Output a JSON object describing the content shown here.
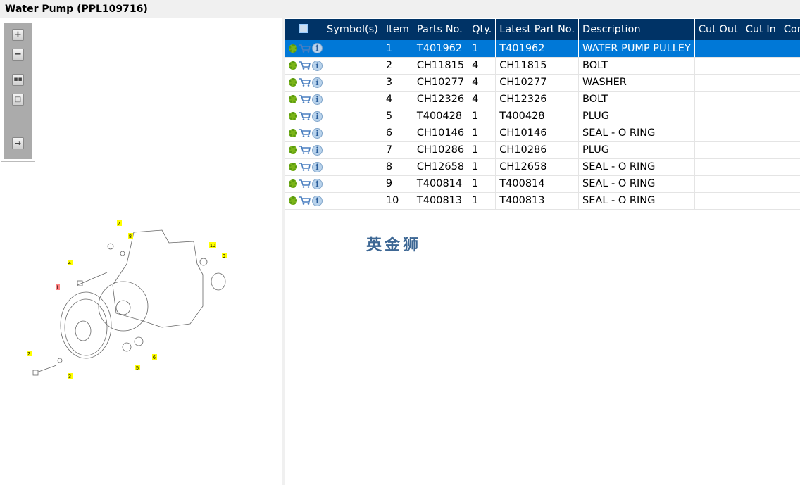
{
  "title": "Water Pump (PPL109716)",
  "toolbar": {
    "zoom_in": "+",
    "zoom_out": "−",
    "fit": "fit",
    "actual": "actual",
    "export": "export"
  },
  "table": {
    "headers": [
      "Symbol(s)",
      "Item",
      "Parts No.",
      "Qty.",
      "Latest Part No.",
      "Description",
      "Cut Out",
      "Cut In",
      "Comment"
    ],
    "rows": [
      {
        "item": "1",
        "part": "T401962",
        "qty": "1",
        "latest": "T401962",
        "desc": "WATER PUMP PULLEY"
      },
      {
        "item": "2",
        "part": "CH11815",
        "qty": "4",
        "latest": "CH11815",
        "desc": "BOLT"
      },
      {
        "item": "3",
        "part": "CH10277",
        "qty": "4",
        "latest": "CH10277",
        "desc": "WASHER"
      },
      {
        "item": "4",
        "part": "CH12326",
        "qty": "4",
        "latest": "CH12326",
        "desc": "BOLT"
      },
      {
        "item": "5",
        "part": "T400428",
        "qty": "1",
        "latest": "T400428",
        "desc": "PLUG"
      },
      {
        "item": "6",
        "part": "CH10146",
        "qty": "1",
        "latest": "CH10146",
        "desc": "SEAL - O RING"
      },
      {
        "item": "7",
        "part": "CH10286",
        "qty": "1",
        "latest": "CH10286",
        "desc": "PLUG"
      },
      {
        "item": "8",
        "part": "CH12658",
        "qty": "1",
        "latest": "CH12658",
        "desc": "SEAL - O RING"
      },
      {
        "item": "9",
        "part": "T400814",
        "qty": "1",
        "latest": "T400814",
        "desc": "SEAL - O RING"
      },
      {
        "item": "10",
        "part": "T400813",
        "qty": "1",
        "latest": "T400813",
        "desc": "SEAL - O RING"
      }
    ],
    "selected_row": 0
  },
  "watermark": "英金狮",
  "diagram": {
    "callouts": [
      "1",
      "2",
      "3",
      "4",
      "5",
      "6",
      "7",
      "8",
      "9",
      "10"
    ],
    "highlight": "1"
  },
  "colors": {
    "header": "#003366",
    "selected": "#0078d7",
    "callout": "#ffff00",
    "callout_selected": "#ff8080"
  }
}
